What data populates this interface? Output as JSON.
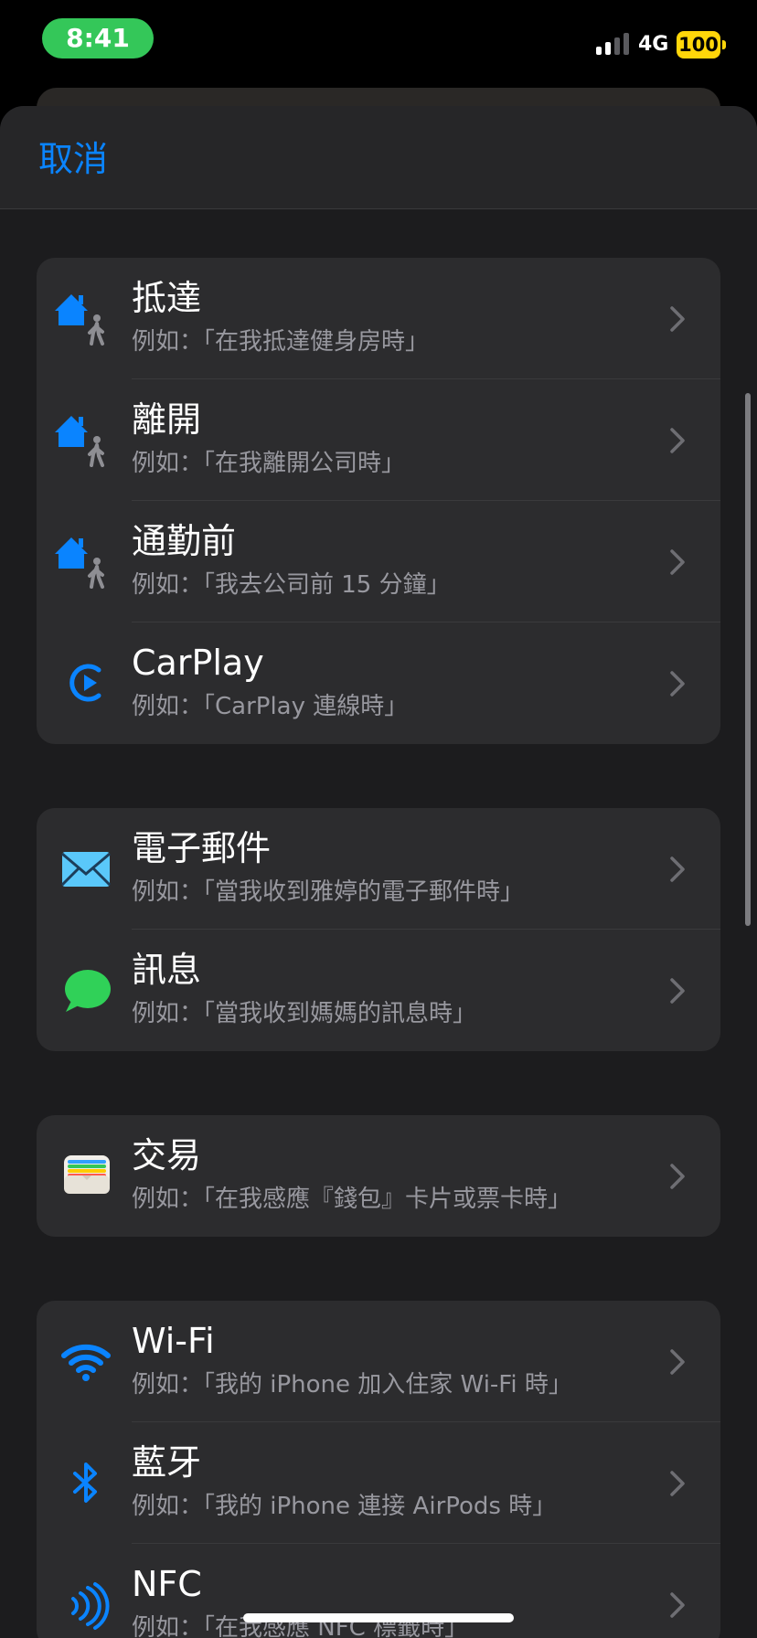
{
  "status_bar": {
    "time": "8:41",
    "network": "4G",
    "battery": "100",
    "signal_bars_active": 2,
    "signal_bars_total": 4,
    "colors": {
      "time_pill": "#34c759",
      "battery": "#ffd60a"
    }
  },
  "sheet": {
    "cancel_label": "取消"
  },
  "groups": [
    {
      "items": [
        {
          "icon": "home-person-icon",
          "title": "抵達",
          "subtitle": "例如：「在我抵達健身房時」"
        },
        {
          "icon": "home-person-icon",
          "title": "離開",
          "subtitle": "例如：「在我離開公司時」"
        },
        {
          "icon": "home-person-icon",
          "title": "通勤前",
          "subtitle": "例如：「我去公司前 15 分鐘」"
        },
        {
          "icon": "carplay-icon",
          "title": "CarPlay",
          "subtitle": "例如：「CarPlay 連線時」"
        }
      ]
    },
    {
      "items": [
        {
          "icon": "mail-icon",
          "title": "電子郵件",
          "subtitle": "例如：「當我收到雅婷的電子郵件時」"
        },
        {
          "icon": "message-icon",
          "title": "訊息",
          "subtitle": "例如：「當我收到媽媽的訊息時」"
        }
      ]
    },
    {
      "items": [
        {
          "icon": "wallet-icon",
          "title": "交易",
          "subtitle": "例如：「在我感應『錢包』卡片或票卡時」"
        }
      ]
    },
    {
      "items": [
        {
          "icon": "wifi-icon",
          "title": "Wi-Fi",
          "subtitle": "例如：「我的 iPhone 加入住家 Wi-Fi 時」"
        },
        {
          "icon": "bluetooth-icon",
          "title": "藍牙",
          "subtitle": "例如：「我的 iPhone 連接 AirPods 時」"
        },
        {
          "icon": "nfc-icon",
          "title": "NFC",
          "subtitle": "例如：「在我感應 NFC 標籤時」"
        }
      ]
    }
  ],
  "colors": {
    "accent": "#0a84ff",
    "message_green": "#30d158",
    "mail_blue": "#5ac8fa",
    "person_gray": "#8e8e93"
  }
}
